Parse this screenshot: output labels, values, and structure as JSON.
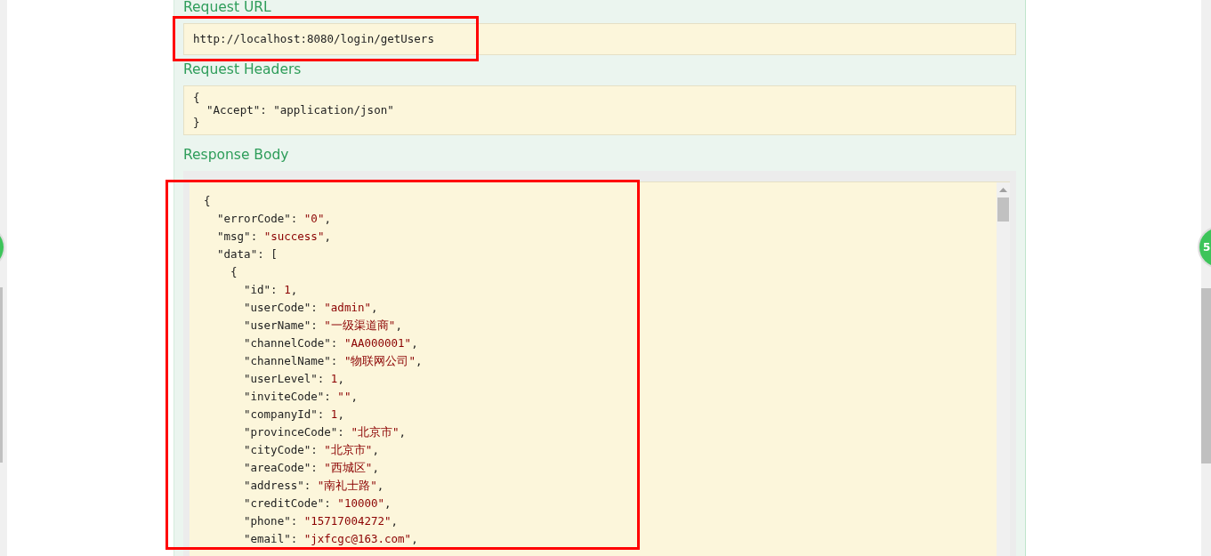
{
  "request_url": {
    "title": "Request URL",
    "value": "http://localhost:8080/login/getUsers",
    "highlighted": true
  },
  "request_headers": {
    "title": "Request Headers",
    "body": {
      "value": "{",
      "kind": "punct",
      "children": [
        {
          "key": "\"Accept\":",
          "value": "\"application/json\"",
          "kind": "plain"
        }
      ],
      "close": "}"
    }
  },
  "response_body": {
    "title": "Response Body",
    "highlighted": true,
    "body": {
      "value": "{",
      "kind": "punct",
      "children": [
        {
          "key": "\"errorCode\":",
          "value": "\"0\"",
          "kind": "literal",
          "end": ","
        },
        {
          "key": "\"msg\":",
          "value": "\"success\"",
          "kind": "literal",
          "end": ","
        },
        {
          "key": "\"data\":",
          "value": "[",
          "kind": "punct",
          "children": [
            {
              "value": "{",
              "kind": "punct",
              "children": [
                {
                  "key": "\"id\":",
                  "value": "1",
                  "kind": "literal",
                  "end": ","
                },
                {
                  "key": "\"userCode\":",
                  "value": "\"admin\"",
                  "kind": "literal",
                  "end": ","
                },
                {
                  "key": "\"userName\":",
                  "value": "\"一级渠道商\"",
                  "kind": "literal",
                  "end": ","
                },
                {
                  "key": "\"channelCode\":",
                  "value": "\"AA000001\"",
                  "kind": "literal",
                  "end": ","
                },
                {
                  "key": "\"channelName\":",
                  "value": "\"物联网公司\"",
                  "kind": "literal",
                  "end": ","
                },
                {
                  "key": "\"userLevel\":",
                  "value": "1",
                  "kind": "literal",
                  "end": ","
                },
                {
                  "key": "\"inviteCode\":",
                  "value": "\"\"",
                  "kind": "literal",
                  "end": ","
                },
                {
                  "key": "\"companyId\":",
                  "value": "1",
                  "kind": "literal",
                  "end": ","
                },
                {
                  "key": "\"provinceCode\":",
                  "value": "\"北京市\"",
                  "kind": "literal",
                  "end": ","
                },
                {
                  "key": "\"cityCode\":",
                  "value": "\"北京市\"",
                  "kind": "literal",
                  "end": ","
                },
                {
                  "key": "\"areaCode\":",
                  "value": "\"西城区\"",
                  "kind": "literal",
                  "end": ","
                },
                {
                  "key": "\"address\":",
                  "value": "\"南礼士路\"",
                  "kind": "literal",
                  "end": ","
                },
                {
                  "key": "\"creditCode\":",
                  "value": "\"10000\"",
                  "kind": "literal",
                  "end": ","
                },
                {
                  "key": "\"phone\":",
                  "value": "\"15717004272\"",
                  "kind": "literal",
                  "end": ","
                },
                {
                  "key": "\"email\":",
                  "value": "\"jxfcgc@163.com\"",
                  "kind": "literal",
                  "end": ","
                }
              ]
            }
          ]
        }
      ]
    }
  },
  "floating_badge": {
    "label": "5"
  }
}
